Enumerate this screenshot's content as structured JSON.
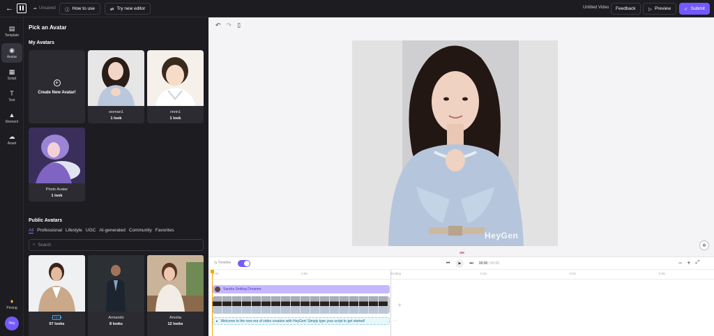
{
  "topbar": {
    "unsaved": "Unsaved",
    "how_to_use": "How to use",
    "try_new_editor": "Try new editor",
    "video_title": "Untitled Video",
    "feedback": "Feedback",
    "preview": "Preview",
    "submit": "Submit",
    "accent": "#7559ff"
  },
  "rail": {
    "items": [
      {
        "label": "Template",
        "icon": "template-icon"
      },
      {
        "label": "Avatar",
        "icon": "avatar-icon"
      },
      {
        "label": "Script",
        "icon": "script-icon"
      },
      {
        "label": "Text",
        "icon": "text-icon"
      },
      {
        "label": "Element",
        "icon": "element-icon"
      },
      {
        "label": "Asset",
        "icon": "asset-icon"
      }
    ],
    "pricing": "Pricing",
    "user_initials": "Hey"
  },
  "panel": {
    "title": "Pick an Avatar",
    "my_avatars_title": "My Avatars",
    "create_new": "Create New Avatar!",
    "my_avatars": [
      {
        "name": "woman1",
        "looks": "1 look"
      },
      {
        "name": "rinrin1",
        "looks": "1 look"
      },
      {
        "name": "Photo Avatar",
        "looks": "1 look"
      }
    ],
    "public_title": "Public Avatars",
    "tabs": [
      "All",
      "Professional",
      "Lifestyle",
      "UGC",
      "AI-generated",
      "Community",
      "Favorites"
    ],
    "search_placeholder": "Search",
    "public_avatars": [
      {
        "name": "Annie",
        "looks": "57 looks",
        "tag": "TEL"
      },
      {
        "name": "Armando",
        "looks": "8 looks"
      },
      {
        "name": "Amelia",
        "looks": "12 looks"
      }
    ]
  },
  "canvas": {
    "watermark": "HeyGen"
  },
  "timeline": {
    "toggle_label": "Timeline",
    "time_current": "00:00",
    "time_total": "/ 00:00",
    "ruler_ticks": [
      "0:00",
      "0:05",
      "Ending",
      "0:15",
      "0:20",
      "0:25",
      "0:30"
    ],
    "avatar_track_label": "Sandra Smiling Dreamer",
    "script_text": "Welcome to the new era of video creation with HeyGen! Simply type your script to get started!"
  }
}
